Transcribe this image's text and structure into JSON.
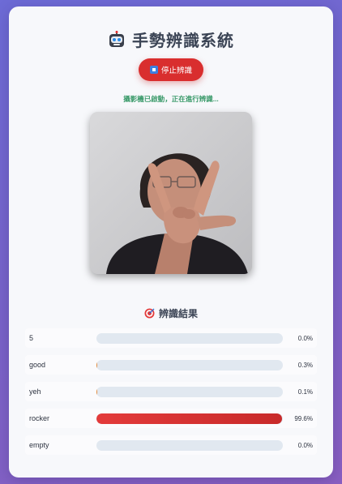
{
  "header": {
    "title": "手勢辨識系統",
    "icon": "robot-icon"
  },
  "controls": {
    "stop_label": "停止辨識",
    "stop_icon": "stop-square-icon"
  },
  "status": {
    "text": "攝影機已啟動，正在進行辨識...",
    "color": "#3a9a6a"
  },
  "camera": {
    "icon": "webcam-feed"
  },
  "results": {
    "title": "辨識結果",
    "icon": "target-icon",
    "accent": "#d92e2e",
    "items": [
      {
        "label": "5",
        "percent_text": "0.0%",
        "value": 0.0
      },
      {
        "label": "good",
        "percent_text": "0.3%",
        "value": 0.3
      },
      {
        "label": "yeh",
        "percent_text": "0.1%",
        "value": 0.1
      },
      {
        "label": "rocker",
        "percent_text": "99.6%",
        "value": 99.6
      },
      {
        "label": "empty",
        "percent_text": "0.0%",
        "value": 0.0
      }
    ]
  }
}
